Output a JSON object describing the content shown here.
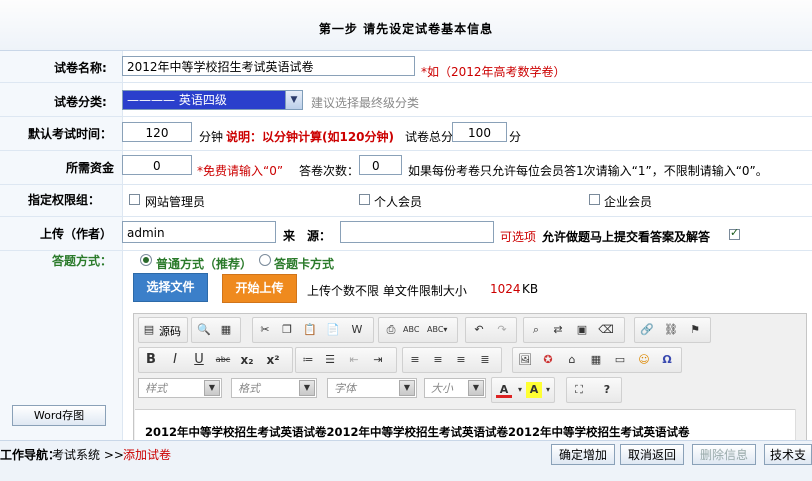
{
  "header": {
    "title": "第一步  请先设定试卷基本信息"
  },
  "exam_name": {
    "label": "试卷名称:",
    "value": "2012年中等学校招生考试英语试卷",
    "hint": "*如（2012年高考数学卷）"
  },
  "category": {
    "label": "试卷分类:",
    "selected": "———— 英语四级",
    "hint": "建议选择最终级分类"
  },
  "time": {
    "label": "默认考试时间：",
    "value": "120",
    "unit": "分钟",
    "note": "说明：以分钟计算(如120分钟)",
    "total_label": "试卷总分",
    "total_value": "100",
    "total_unit": "分"
  },
  "funds": {
    "label": "所需资金",
    "value": "0",
    "free_hint": "*免费请输入“0”",
    "count_label": "答卷次数：",
    "count_value": "0",
    "count_hint": "如果每份考卷只允许每位会员答1次请输入“1”，不限制请输入“0”。"
  },
  "permissions": {
    "label": "指定权限组：",
    "options": [
      "网站管理员",
      "个人会员",
      "企业会员"
    ]
  },
  "uploader": {
    "label": "上传（作者）",
    "value": "admin",
    "source_label": "来　源：",
    "source_value": "",
    "optional": "可选项",
    "allow_label": "允许做题马上提交看答案及解答"
  },
  "answer_mode": {
    "label": "答题方式：",
    "options": [
      "普通方式（推荐）",
      "答题卡方式"
    ]
  },
  "upload": {
    "choose": "选择文件",
    "start": "开始上传",
    "info": "上传个数不限  单文件限制大小",
    "size": "1024",
    "size_unit": "KB"
  },
  "editor": {
    "source_label": "源码",
    "combos": [
      "样式",
      "格式",
      "字体",
      "大小"
    ],
    "content": "2012年中等学校招生考试英语试卷2012年中等学校招生考试英语试卷2012年中等学校招生考试英语试卷"
  },
  "word_button": "Word存图",
  "footer": {
    "nav_label": "工作导航：",
    "nav_item": "考试系统 >>",
    "nav_current": "添加试卷",
    "buttons": [
      "确定增加",
      "取消返回",
      "删除信息",
      "技术支"
    ]
  },
  "colors": {
    "accent_blue": "#3b7fc9",
    "accent_orange": "#ef8a1e",
    "red": "#cc0000",
    "green_label": "#2a7a2a"
  }
}
